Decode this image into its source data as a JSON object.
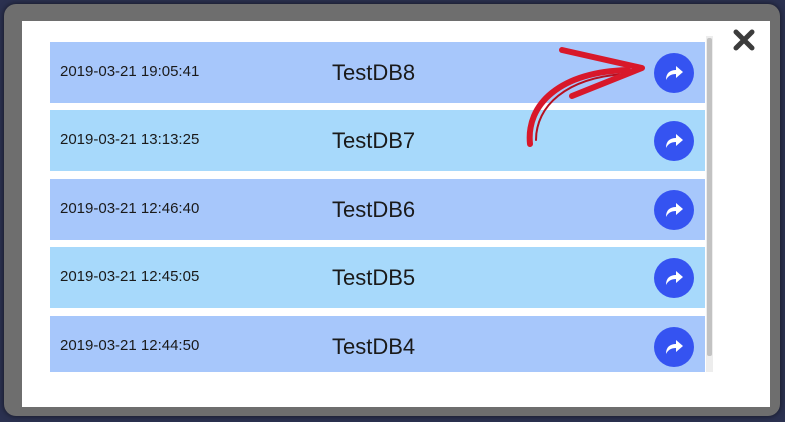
{
  "dialog": {
    "close_icon": "close-icon",
    "rows": [
      {
        "date": "2019-03-21 19:05:41",
        "name": "TestDB8",
        "action_icon": "share-arrow-icon"
      },
      {
        "date": "2019-03-21 13:13:25",
        "name": "TestDB7",
        "action_icon": "share-arrow-icon"
      },
      {
        "date": "2019-03-21 12:46:40",
        "name": "TestDB6",
        "action_icon": "share-arrow-icon"
      },
      {
        "date": "2019-03-21 12:45:05",
        "name": "TestDB5",
        "action_icon": "share-arrow-icon"
      },
      {
        "date": "2019-03-21 12:44:50",
        "name": "TestDB4",
        "action_icon": "share-arrow-icon"
      }
    ]
  },
  "colors": {
    "row_primary": "#a7c7fb",
    "row_secondary": "#a7d9fb",
    "button": "#3553f1",
    "annotation_arrow": "#d8182a"
  }
}
